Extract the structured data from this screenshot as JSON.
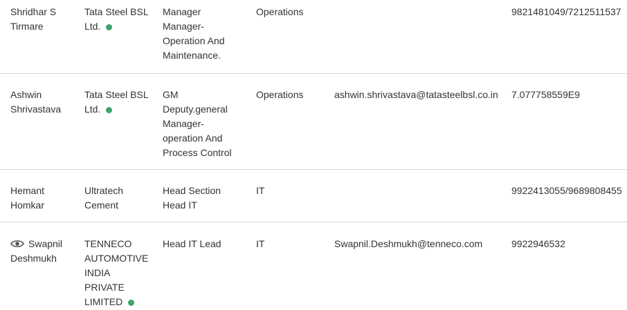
{
  "rows": [
    {
      "name": [
        "Shridhar S",
        "Tirmare"
      ],
      "company": [
        "Tata Steel BSL",
        "Ltd."
      ],
      "company_verified": true,
      "designation": [
        "Manager",
        "Manager-",
        "Operation And",
        "Maintenance."
      ],
      "department": "Operations",
      "email": "",
      "phone": "9821481049/7212511537",
      "viewed": false
    },
    {
      "name": [
        "Ashwin",
        "Shrivastava"
      ],
      "company": [
        "Tata Steel BSL",
        "Ltd."
      ],
      "company_verified": true,
      "designation": [
        "GM",
        "Deputy.general",
        "Manager-",
        "operation And",
        "Process Control"
      ],
      "department": "Operations",
      "email": "ashwin.shrivastava@tatasteelbsl.co.in",
      "phone": "7.077758559E9",
      "viewed": false
    },
    {
      "name": [
        "Hemant",
        "Homkar"
      ],
      "company": [
        "Ultratech",
        "Cement"
      ],
      "company_verified": false,
      "designation": [
        "Head Section",
        "Head IT"
      ],
      "department": "IT",
      "email": "",
      "phone": "9922413055/9689808455",
      "viewed": false
    },
    {
      "name": [
        "Swapnil",
        "Deshmukh"
      ],
      "company": [
        "TENNECO",
        "AUTOMOTIVE",
        "INDIA",
        "PRIVATE",
        "LIMITED"
      ],
      "company_verified": true,
      "designation": [
        "Head IT Lead"
      ],
      "department": "IT",
      "email": "Swapnil.Deshmukh@tenneco.com",
      "phone": "9922946532",
      "viewed": true
    }
  ],
  "colors": {
    "verified_dot": "#3fa36b",
    "divider": "#d9d9d9",
    "text": "#333333"
  },
  "icons": {
    "verified": "green-dot",
    "viewed": "eye-icon"
  }
}
